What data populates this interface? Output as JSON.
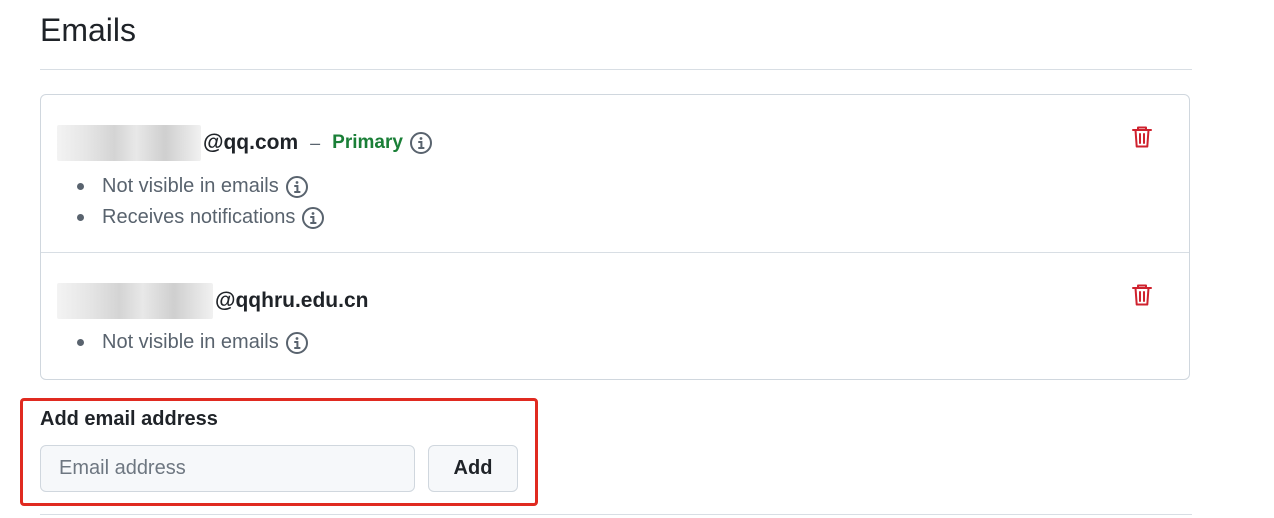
{
  "page": {
    "title": "Emails"
  },
  "emails": [
    {
      "address_suffix": "@qq.com",
      "separator": "–",
      "primary_label": "Primary",
      "bullets": [
        "Not visible in emails",
        "Receives notifications"
      ]
    },
    {
      "address_suffix": "@qqhru.edu.cn",
      "bullets": [
        "Not visible in emails"
      ]
    }
  ],
  "add_email": {
    "label": "Add email address",
    "placeholder": "Email address",
    "button_label": "Add"
  },
  "colors": {
    "primary_green": "#1a7f37",
    "delete_red": "#cf222e",
    "highlight_border": "#e02a20"
  },
  "icons": {
    "info": "info-icon",
    "delete": "trash-icon"
  }
}
